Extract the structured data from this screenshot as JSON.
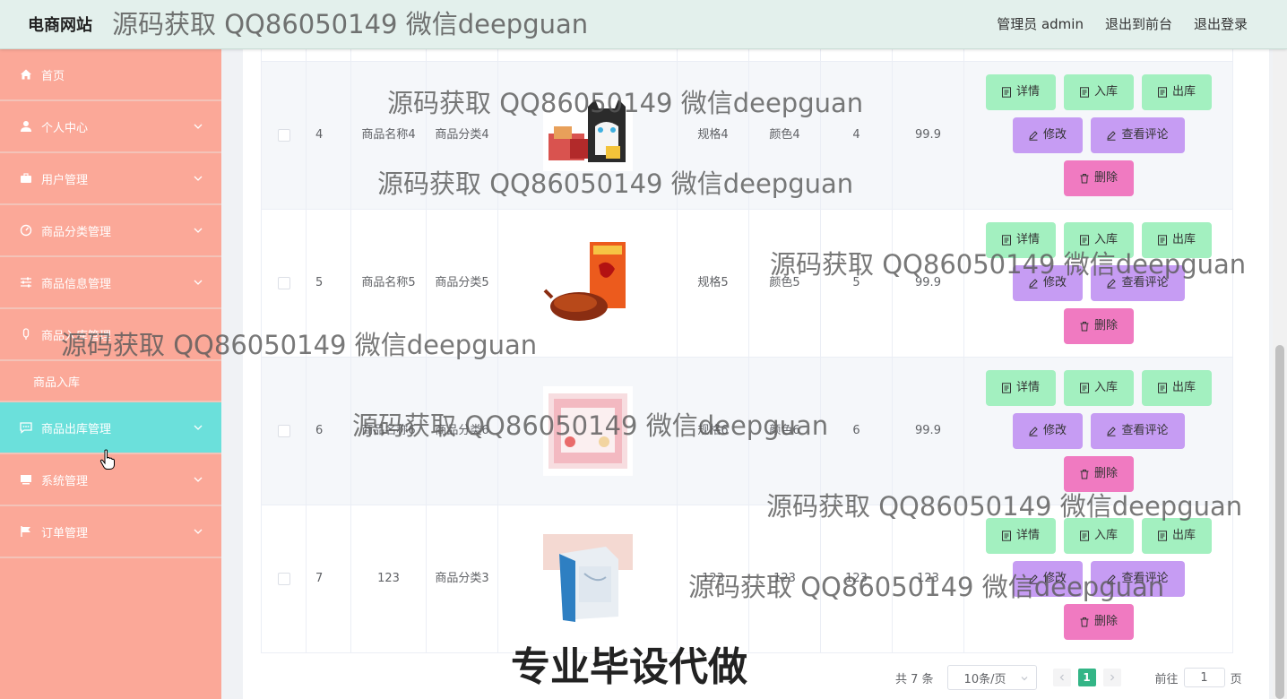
{
  "header": {
    "site_title": "电商网站",
    "admin_label": "管理员 admin",
    "front_label": "退出到前台",
    "logout_label": "退出登录"
  },
  "sidebar": {
    "items": [
      {
        "label": "首页",
        "icon": "home-icon"
      },
      {
        "label": "个人中心",
        "icon": "user-icon"
      },
      {
        "label": "用户管理",
        "icon": "briefcase-icon"
      },
      {
        "label": "商品分类管理",
        "icon": "gauge-icon"
      },
      {
        "label": "商品信息管理",
        "icon": "sliders-icon"
      },
      {
        "label": "商品入库管理",
        "icon": "mic-icon"
      },
      {
        "label": "商品入库"
      },
      {
        "label": "商品出库管理",
        "icon": "chat-icon"
      },
      {
        "label": "系统管理",
        "icon": "monitor-icon"
      },
      {
        "label": "订单管理",
        "icon": "flag-icon"
      }
    ]
  },
  "table": {
    "rows": [
      {
        "idx": "4",
        "name": "商品名称4",
        "category": "商品分类4",
        "spec": "规格4",
        "color": "颜色4",
        "stock": "4",
        "price": "99.9",
        "image": "snack-cat-box"
      },
      {
        "idx": "5",
        "name": "商品名称5",
        "category": "商品分类5",
        "spec": "规格5",
        "color": "颜色5",
        "stock": "5",
        "price": "99.9",
        "image": "roast-duck-box"
      },
      {
        "idx": "6",
        "name": "商品名称6",
        "category": "商品分类6",
        "spec": "规格6",
        "color": "颜色6",
        "stock": "6",
        "price": "99.9",
        "image": "pink-gift-box"
      },
      {
        "idx": "7",
        "name": "123",
        "category": "商品分类3",
        "spec": "123",
        "color": "123",
        "stock": "123",
        "price": "123",
        "image": "medicine-box"
      }
    ],
    "actions": {
      "detail": "详情",
      "stock_in": "入库",
      "stock_out": "出库",
      "edit": "修改",
      "comments": "查看评论",
      "delete": "删除"
    }
  },
  "pagination": {
    "total": "共 7 条",
    "page_size": "10条/页",
    "current_page": "1",
    "goto_label": "前往",
    "goto_value": "1",
    "page_unit": "页"
  },
  "watermarks": {
    "text": "源码获取 QQ86050149 微信deepguan",
    "bottom": "专业毕设代做"
  },
  "colors": {
    "sidebar": "#fba898",
    "sidebar_active": "#6be0db",
    "btn_green": "#a3f0c0",
    "btn_purple": "#c69cf3",
    "btn_pink": "#f07ac1",
    "page_active": "#33b586"
  }
}
